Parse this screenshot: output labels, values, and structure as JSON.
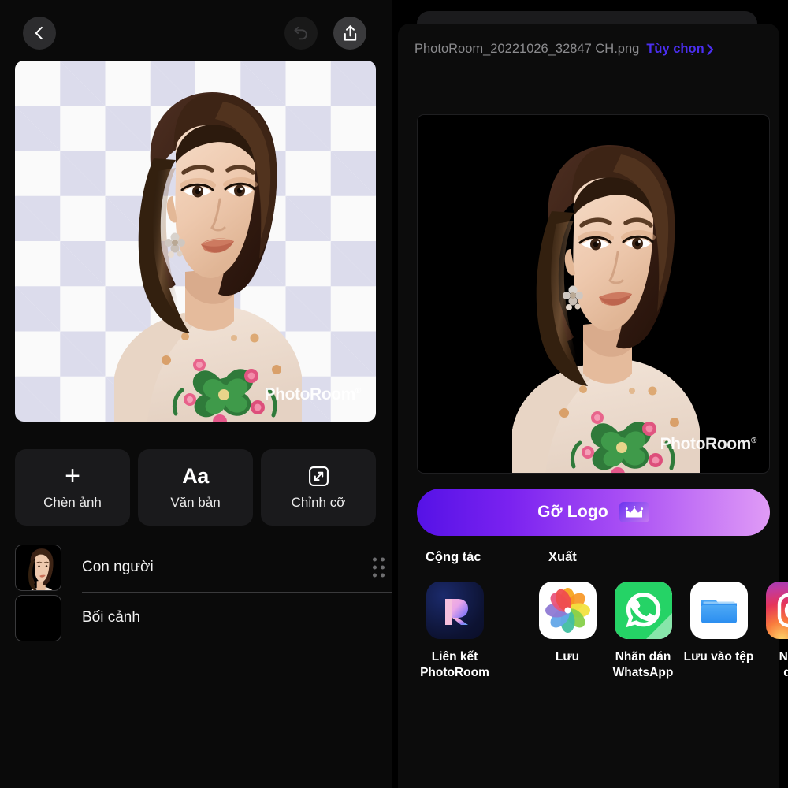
{
  "app": "PhotoRoom",
  "editor": {
    "toolbar": {
      "back_label": "Back",
      "undo_label": "Undo",
      "share_label": "Share"
    },
    "canvas": {
      "watermark": "PhotoRoom",
      "watermark_mark": "®",
      "background": "transparent-checkerboard",
      "checker_light": "#fafafa",
      "checker_dark": "#dcdcec"
    },
    "tools": [
      {
        "icon": "plus-icon",
        "glyph": "+",
        "label": "Chèn ảnh"
      },
      {
        "icon": "text-icon",
        "glyph": "Aa",
        "label": "Văn bản"
      },
      {
        "icon": "resize-icon",
        "glyph": "",
        "label": "Chỉnh cỡ"
      }
    ],
    "layers": [
      {
        "name": "Con người",
        "thumb": "person-photo",
        "has_handle": true
      },
      {
        "name": "Bối cảnh",
        "thumb": "empty-black",
        "has_handle": false
      }
    ]
  },
  "share": {
    "file_name": "PhotoRoom_20221026_32847 CH.png",
    "options_label": "Tùy chọn",
    "options_chevron": "›",
    "options_color": "#4b2ff0",
    "preview_watermark": "PhotoRoom",
    "preview_watermark_mark": "®",
    "remove_logo": {
      "label": "Gỡ Logo",
      "badge_icon": "crown-icon",
      "gradient_from": "#5512e6",
      "gradient_to": "#e09bf6"
    },
    "sections": [
      {
        "key": "collab",
        "label": "Cộng tác"
      },
      {
        "key": "export",
        "label": "Xuất"
      }
    ],
    "items": [
      {
        "icon": "photoroom-app-icon",
        "label": "Liên kết\nPhotoRoom",
        "section": "collab"
      },
      {
        "icon": "apple-photos-icon",
        "label": "Lưu",
        "section": "export"
      },
      {
        "icon": "whatsapp-icon",
        "label": "Nhãn dán\nWhatsApp",
        "section": "export"
      },
      {
        "icon": "files-folder-icon",
        "label": "Lưu vào tệp",
        "section": "export"
      },
      {
        "icon": "instagram-icon",
        "label": "Nhãn\ndán",
        "section": "export"
      }
    ]
  }
}
